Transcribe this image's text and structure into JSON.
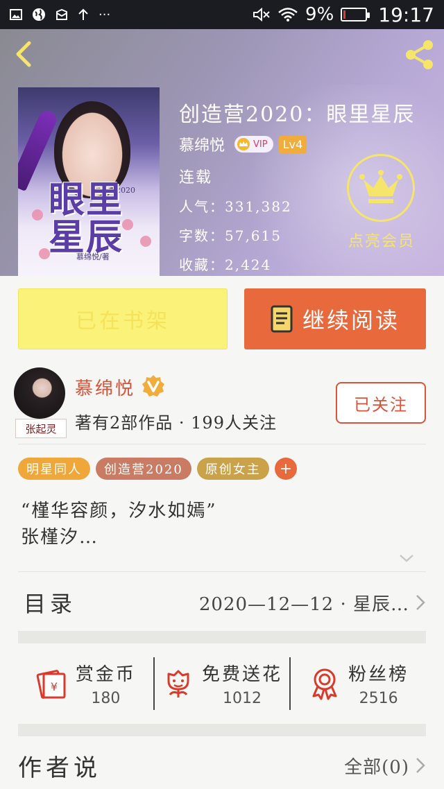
{
  "status_bar": {
    "battery_percent": "9%",
    "battery_level": 0.09,
    "time": "19:17"
  },
  "book": {
    "title": "创造营2020：眼里星辰",
    "author": "慕绵悦",
    "vip_label": "VIP",
    "level": "Lv4",
    "status": "连载",
    "popularity": "人气：331,382",
    "word_count": "字数：57,615",
    "favorites": "收藏：2,424",
    "cover": {
      "title_text": "眼里星辰",
      "series_text": "创造营2020",
      "author_text": "慕绵悦/著"
    }
  },
  "member": {
    "label": "点亮会员"
  },
  "actions": {
    "shelf_label": "已在书架",
    "read_label": "继续阅读"
  },
  "author_card": {
    "name": "慕绵悦",
    "avatar_caption": "张起灵",
    "info": "著有2部作品 · 199人关注",
    "follow_label": "已关注"
  },
  "tags": [
    {
      "label": "明星同人",
      "color": "#f0a73a"
    },
    {
      "label": "创造营2020",
      "color": "#c97b63"
    },
    {
      "label": "原创女主",
      "color": "#c9a24a"
    }
  ],
  "intro": {
    "line1": "“槿华容颜，汐水如嫣”",
    "line2": "张槿汐…"
  },
  "toc": {
    "label": "目录",
    "latest": "2020—12—12 · 星辰…"
  },
  "stats": [
    {
      "label": "赏金币",
      "value": "180",
      "icon": "red-envelope-icon"
    },
    {
      "label": "免费送花",
      "value": "1012",
      "icon": "flower-icon"
    },
    {
      "label": "粉丝榜",
      "value": "2516",
      "icon": "award-ribbon-icon"
    }
  ],
  "author_says": {
    "title": "作者说",
    "all_label": "全部(0)"
  },
  "colors": {
    "accent": "#e8693c",
    "shelf_yellow": "#fbf27a",
    "author_red": "#d9533a",
    "member_yellow": "#f5e66b"
  }
}
